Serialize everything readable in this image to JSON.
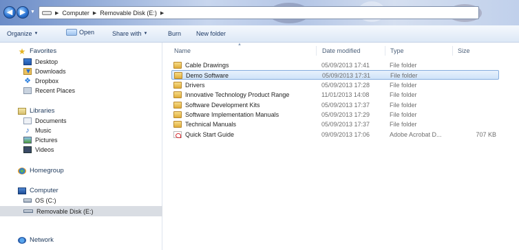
{
  "address": {
    "crumbs": [
      "Computer",
      "Removable Disk (E:)"
    ]
  },
  "toolbar": {
    "organize": "Organize",
    "open": "Open",
    "share_with": "Share with",
    "burn": "Burn",
    "new_folder": "New folder"
  },
  "nav": {
    "favorites": "Favorites",
    "desktop": "Desktop",
    "downloads": "Downloads",
    "dropbox": "Dropbox",
    "recent_places": "Recent Places",
    "libraries": "Libraries",
    "documents": "Documents",
    "music": "Music",
    "pictures": "Pictures",
    "videos": "Videos",
    "homegroup": "Homegroup",
    "computer": "Computer",
    "os_drive": "OS (C:)",
    "removable_disk": "Removable Disk (E:)",
    "network": "Network"
  },
  "columns": {
    "name": "Name",
    "date_modified": "Date modified",
    "type": "Type",
    "size": "Size"
  },
  "files": [
    {
      "name": "Cable Drawings",
      "date": "05/09/2013 17:41",
      "type": "File folder",
      "size": "",
      "icon": "folder-icon"
    },
    {
      "name": "Demo Software",
      "date": "05/09/2013 17:31",
      "type": "File folder",
      "size": "",
      "icon": "folder-icon",
      "selected": true
    },
    {
      "name": "Drivers",
      "date": "05/09/2013 17:28",
      "type": "File folder",
      "size": "",
      "icon": "folder-icon"
    },
    {
      "name": "Innovative Technology Product Range",
      "date": "11/01/2013 14:08",
      "type": "File folder",
      "size": "",
      "icon": "folder-icon"
    },
    {
      "name": "Software Development Kits",
      "date": "05/09/2013 17:37",
      "type": "File folder",
      "size": "",
      "icon": "folder-icon"
    },
    {
      "name": "Software Implementation Manuals",
      "date": "05/09/2013 17:29",
      "type": "File folder",
      "size": "",
      "icon": "folder-icon"
    },
    {
      "name": "Technical Manuals",
      "date": "05/09/2013 17:37",
      "type": "File folder",
      "size": "",
      "icon": "folder-icon"
    },
    {
      "name": "Quick Start Guide",
      "date": "09/09/2013 17:06",
      "type": "Adobe Acrobat D...",
      "size": "707 KB",
      "icon": "pdf-icon"
    }
  ]
}
